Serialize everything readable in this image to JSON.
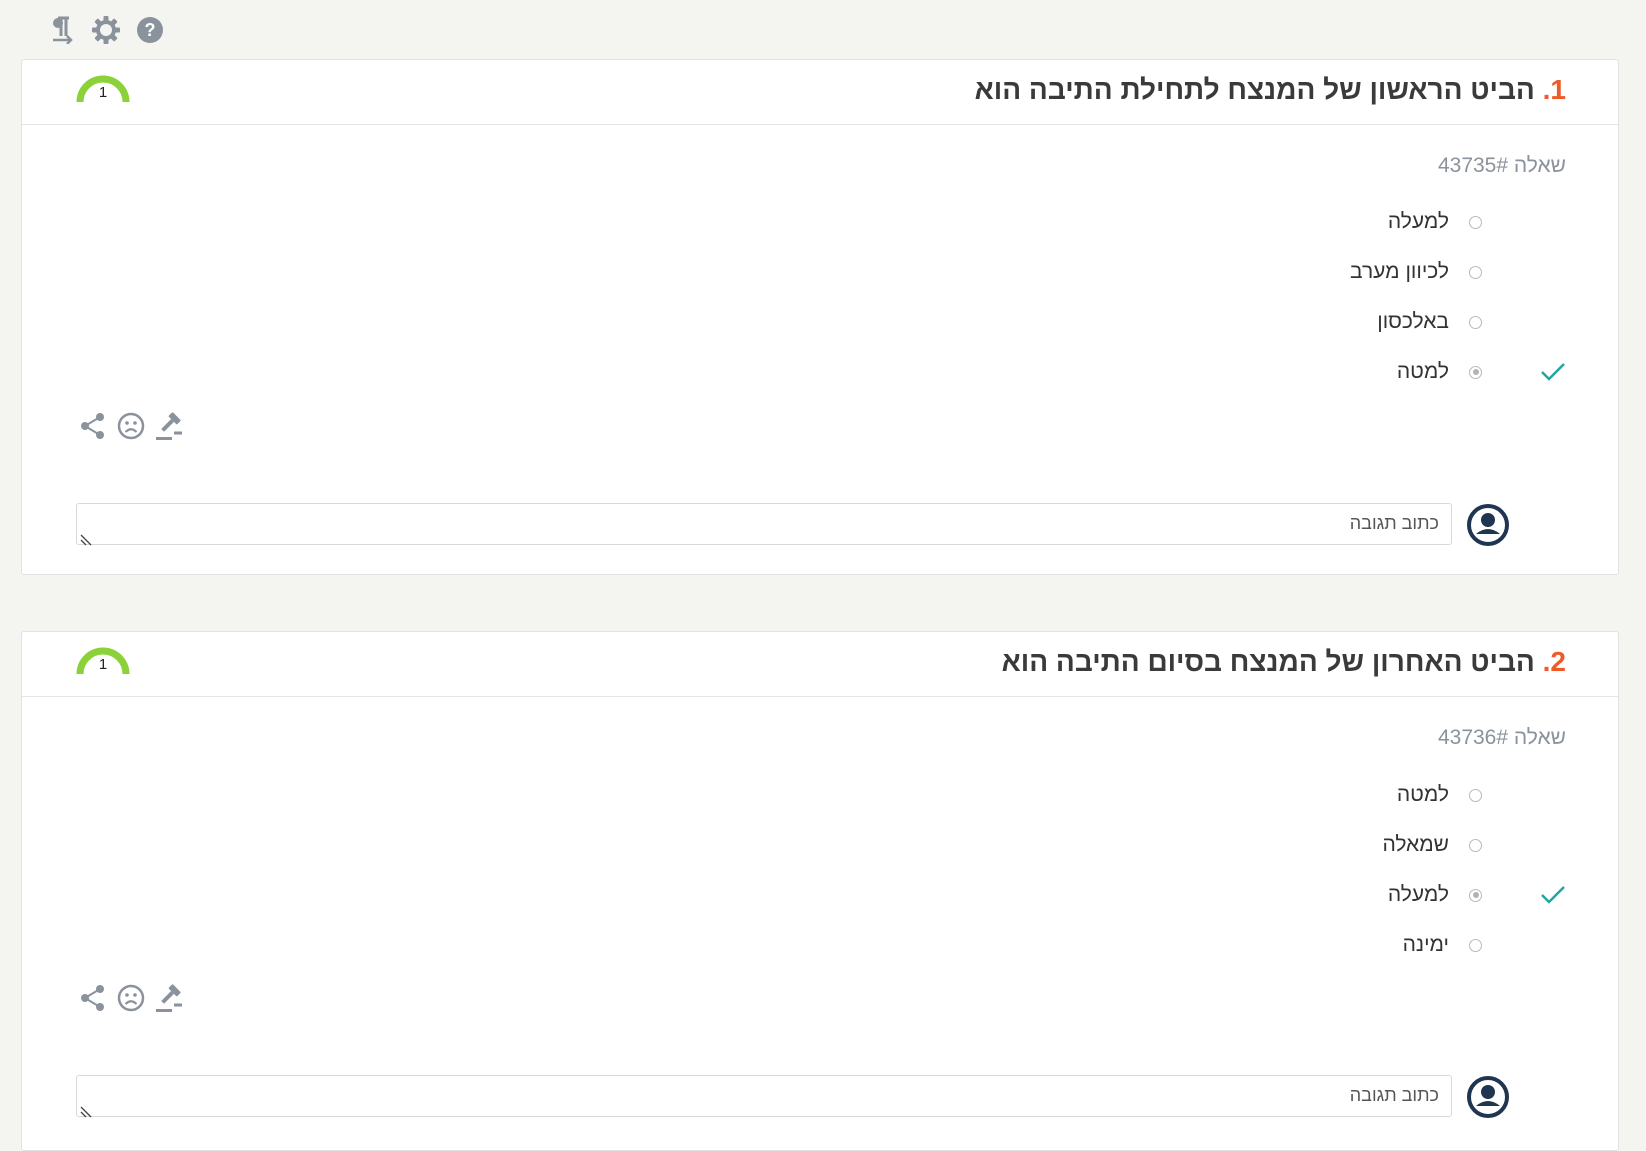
{
  "toolbar": {
    "icons": [
      "pilcrow-rtl-icon",
      "settings-gear-icon",
      "help-icon"
    ]
  },
  "colors": {
    "accent_number": "#f05a28",
    "check": "#1fa7a0",
    "gauge_green": "#8bd13a",
    "avatar": "#1f3550",
    "icon_gray": "#8a929c"
  },
  "questions": [
    {
      "number": "1.",
      "title": "הביט הראשון של המנצח לתחילת התיבה הוא",
      "gauge_value": "1",
      "question_id": "שאלה 43735#",
      "options": [
        {
          "label": "למעלה",
          "checked": false,
          "correct": false
        },
        {
          "label": "לכיוון מערב",
          "checked": false,
          "correct": false
        },
        {
          "label": "באלכסון",
          "checked": false,
          "correct": false
        },
        {
          "label": "למטה",
          "checked": true,
          "correct": true
        }
      ],
      "reply_placeholder": "כתוב תגובה"
    },
    {
      "number": "2.",
      "title": "הביט האחרון של המנצח בסיום התיבה הוא",
      "gauge_value": "1",
      "question_id": "שאלה 43736#",
      "options": [
        {
          "label": "למטה",
          "checked": false,
          "correct": false
        },
        {
          "label": "שמאלה",
          "checked": false,
          "correct": false
        },
        {
          "label": "למעלה",
          "checked": true,
          "correct": true
        },
        {
          "label": "ימינה",
          "checked": false,
          "correct": false
        }
      ],
      "reply_placeholder": "כתוב תגובה"
    }
  ]
}
